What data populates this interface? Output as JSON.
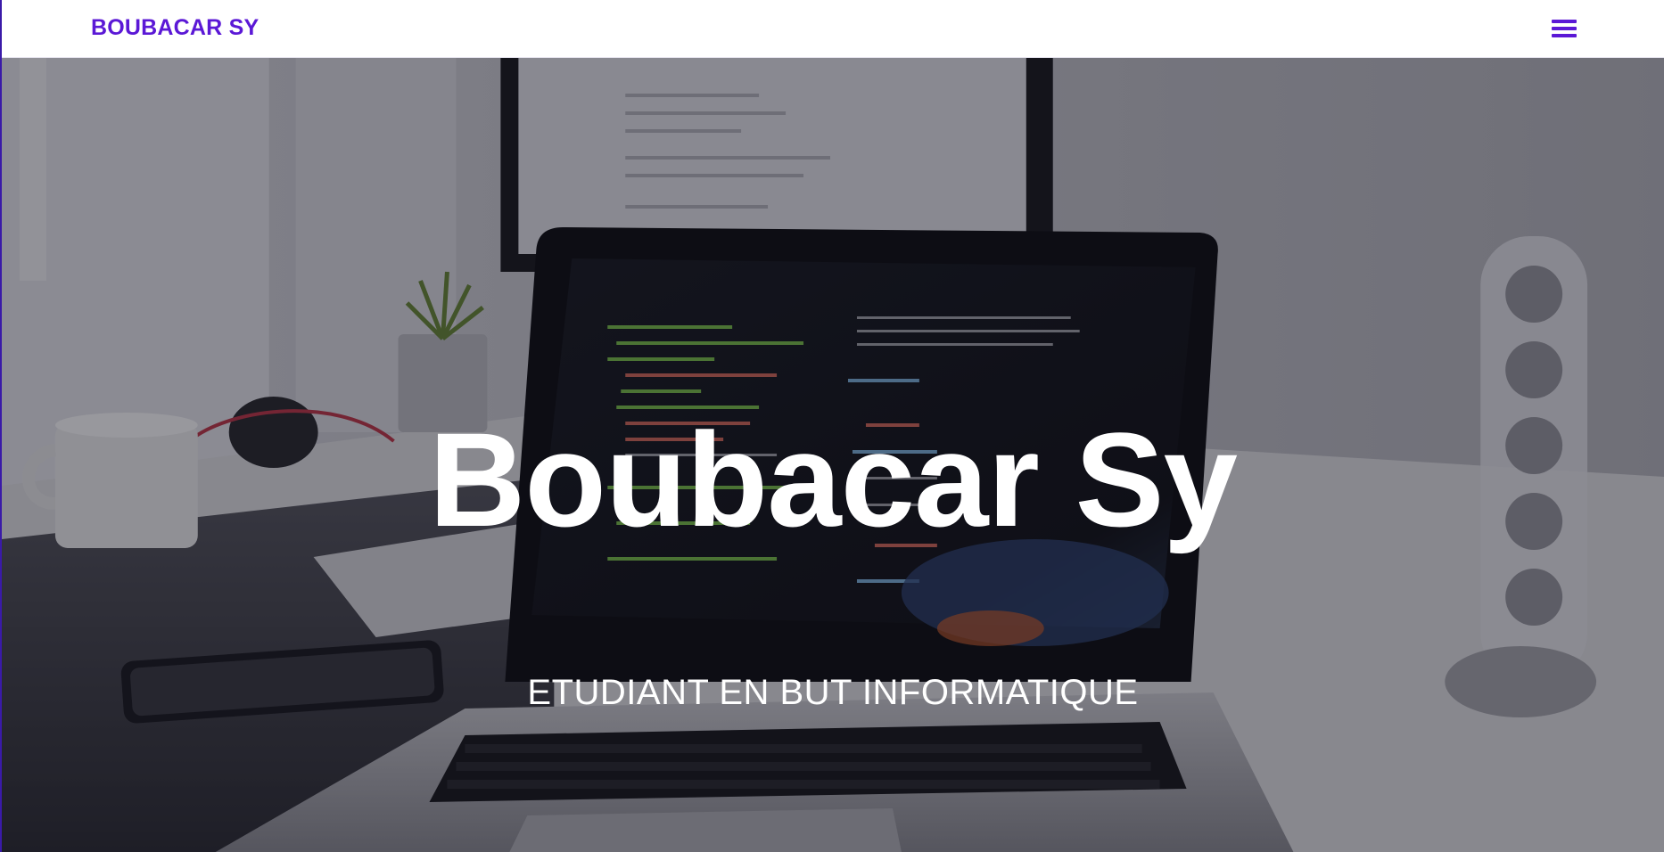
{
  "header": {
    "brand": "BOUBACAR SY",
    "menu_icon": "hamburger-menu-icon",
    "accent_color": "#5b18d6"
  },
  "hero": {
    "title": "Boubacar Sy",
    "subtitle": "ETUDIANT EN BUT INFORMATIQUE",
    "text_color": "#ffffff"
  }
}
